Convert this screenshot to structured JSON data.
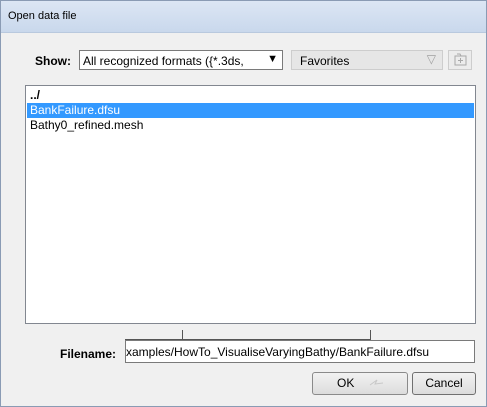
{
  "window": {
    "title": "Open data file"
  },
  "toolbar": {
    "show_label": "Show:",
    "show_value": "All recognized formats ({*.3ds,",
    "favorites_value": "Favorites"
  },
  "files": [
    {
      "name": "../",
      "selected": false
    },
    {
      "name": "BankFailure.dfsu",
      "selected": true
    },
    {
      "name": "Bathy0_refined.mesh",
      "selected": false
    }
  ],
  "filename": {
    "label": "Filename:",
    "value": "xamples/HowTo_VisualiseVaryingBathy/BankFailure.dfsu"
  },
  "buttons": {
    "ok": "OK",
    "cancel": "Cancel"
  },
  "colors": {
    "selection": "#3399ff",
    "titlebar": "#dce6f4"
  },
  "icons": {
    "dropdown": "chevron-down-icon",
    "add_favorite": "add-folder-icon",
    "cursor": "mouse-cursor-icon"
  }
}
